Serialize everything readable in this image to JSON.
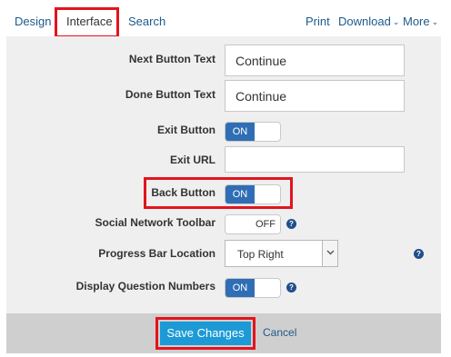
{
  "nav": {
    "tabs": [
      "Design",
      "Interface",
      "Search"
    ],
    "print": "Print",
    "download": "Download",
    "more": "More"
  },
  "form": {
    "next_button_text": {
      "label": "Next Button Text",
      "value": "Continue"
    },
    "done_button_text": {
      "label": "Done Button Text",
      "value": "Continue"
    },
    "exit_button": {
      "label": "Exit Button",
      "state": "ON"
    },
    "exit_url": {
      "label": "Exit URL",
      "value": ""
    },
    "back_button": {
      "label": "Back Button",
      "state": "ON"
    },
    "social_toolbar": {
      "label": "Social Network Toolbar",
      "state": "OFF"
    },
    "progress_bar_location": {
      "label": "Progress Bar Location",
      "value": "Top Right"
    },
    "display_question_numbers": {
      "label": "Display Question Numbers",
      "state": "ON"
    }
  },
  "help_glyph": "?",
  "footer": {
    "save": "Save Changes",
    "cancel": "Cancel"
  },
  "colors": {
    "highlight": "#e2141e",
    "toggle_on": "#2f6eb5",
    "save_button": "#1d9ad6",
    "link": "#1e5a8c"
  },
  "icons": [
    "chevron-down-icon",
    "help-icon"
  ]
}
